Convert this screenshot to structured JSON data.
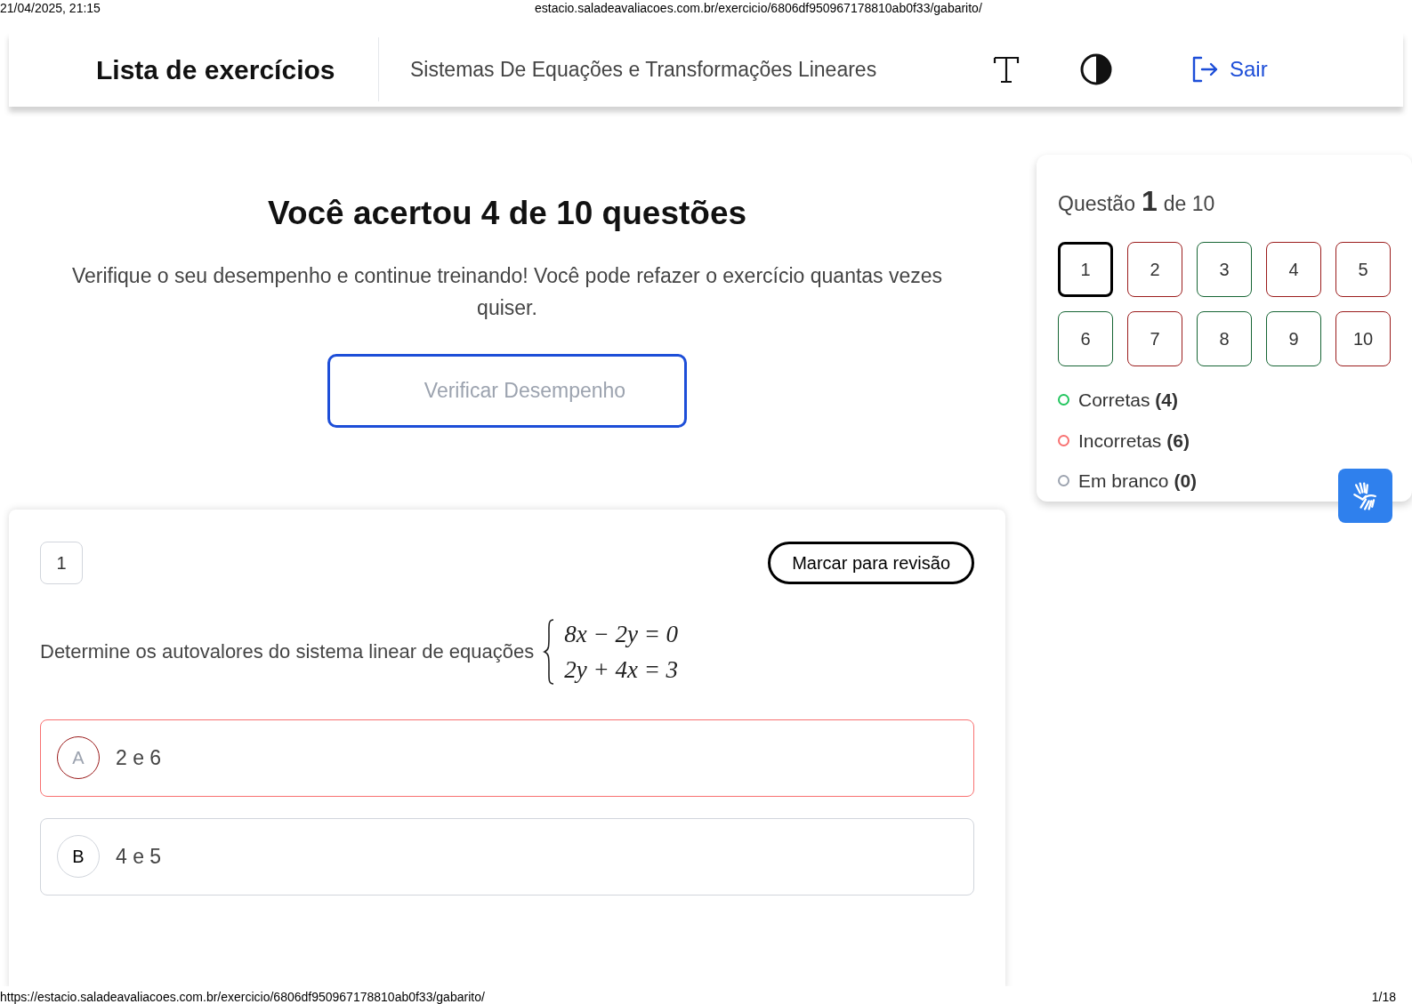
{
  "print_header": {
    "date": "21/04/2025, 21:15",
    "url": "estacio.saladeavaliacoes.com.br/exercicio/6806df950967178810ab0f33/gabarito/"
  },
  "navbar": {
    "title": "Lista de exercícios",
    "subtitle": "Sistemas De Equações e Transformações Lineares",
    "logout": "Sair"
  },
  "result": {
    "heading": "Você acertou 4 de 10 questões",
    "message": "Verifique o seu desempenho e continue treinando! Você pode refazer o exercício quantas vezes quiser.",
    "button": "Verificar Desempenho"
  },
  "navigator": {
    "prefix": "Questão",
    "current": "1",
    "suffix": "de 10",
    "questions": [
      {
        "label": "1",
        "selected": true
      },
      {
        "label": "2",
        "selected": false,
        "correct": false
      },
      {
        "label": "3",
        "selected": false,
        "correct": true
      },
      {
        "label": "4",
        "selected": false,
        "correct": false
      },
      {
        "label": "5",
        "selected": false,
        "correct": false
      },
      {
        "label": "6",
        "selected": false,
        "correct": true
      },
      {
        "label": "7",
        "selected": false,
        "correct": false
      },
      {
        "label": "8",
        "selected": false,
        "correct": true
      },
      {
        "label": "9",
        "selected": false,
        "correct": true
      },
      {
        "label": "10",
        "selected": false,
        "correct": false
      }
    ],
    "legend": [
      {
        "label": "Corretas **(4)**",
        "color": "#22c55e"
      },
      {
        "label": "Incorretas **(6)**",
        "color": "#f87171"
      },
      {
        "label": "Em branco **(0)**",
        "color": "#9ca3af"
      }
    ]
  },
  "question": {
    "number": "1",
    "review_button": "Marcar para revisão",
    "text": "Determine os autovalores do sistema linear de equações",
    "equations": [
      "8x − 2y = 0",
      "2y + 4x = 3"
    ],
    "options": [
      {
        "letter": "A",
        "text": "2 e 6",
        "selected": true,
        "correct": false
      },
      {
        "letter": "B",
        "text": "4 e 5",
        "selected": false
      }
    ]
  },
  "print_footer": {
    "url": "https://estacio.saladeavaliacoes.com.br/exercicio/6806df950967178810ab0f33/gabarito/",
    "page": "1/18"
  }
}
